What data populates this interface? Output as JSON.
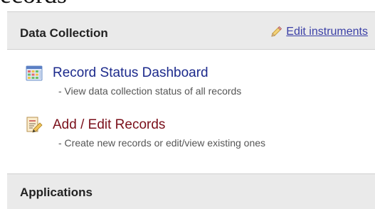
{
  "page": {
    "title_fragment": "ecords"
  },
  "data_collection": {
    "title": "Data Collection",
    "edit_link": "Edit instruments",
    "items": [
      {
        "label": "Record Status Dashboard",
        "description": "- View data collection status of all records",
        "icon": "dashboard-grid-icon",
        "color": "#1c2a8c"
      },
      {
        "label": "Add / Edit Records",
        "description": "- Create new records or edit/view existing ones",
        "icon": "edit-record-icon",
        "color": "#7a0f1a"
      }
    ]
  },
  "applications": {
    "title": "Applications"
  }
}
